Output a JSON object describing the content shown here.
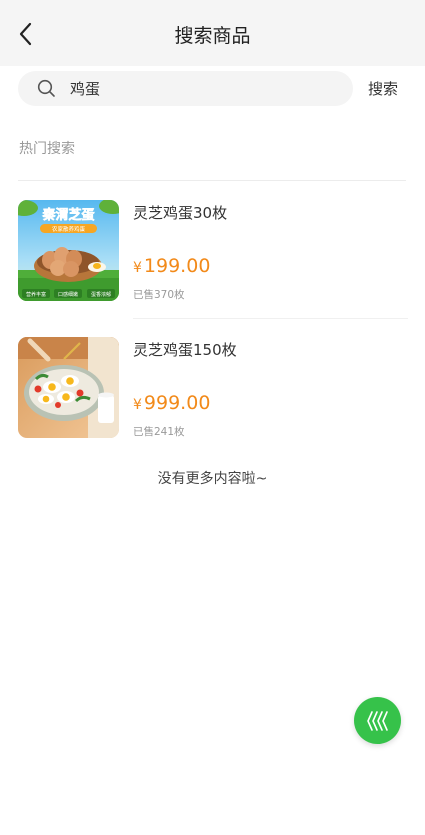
{
  "header": {
    "title": "搜索商品",
    "back_icon": "chevron-left-icon"
  },
  "search": {
    "value": "鸡蛋",
    "placeholder": "",
    "button_label": "搜索",
    "icon": "search-icon"
  },
  "hot_search": {
    "label": "热门搜索"
  },
  "products": [
    {
      "name": "灵芝鸡蛋30枚",
      "currency": "¥",
      "price": "199.00",
      "sold": "已售370枚",
      "image": {
        "title": "秦渭芝蛋",
        "banner": "农家散养鸡蛋",
        "badges": [
          "营养丰富",
          "口感细嫩",
          "蛋香浓郁"
        ]
      }
    },
    {
      "name": "灵芝鸡蛋150枚",
      "currency": "¥",
      "price": "999.00",
      "sold": "已售241枚"
    }
  ],
  "footer": {
    "no_more": "没有更多内容啦~"
  },
  "fab": {
    "icon": "arrows-icon"
  },
  "colors": {
    "price": "#f28a1a",
    "fab": "#36c24a",
    "header_bg": "#f5f5f5"
  }
}
